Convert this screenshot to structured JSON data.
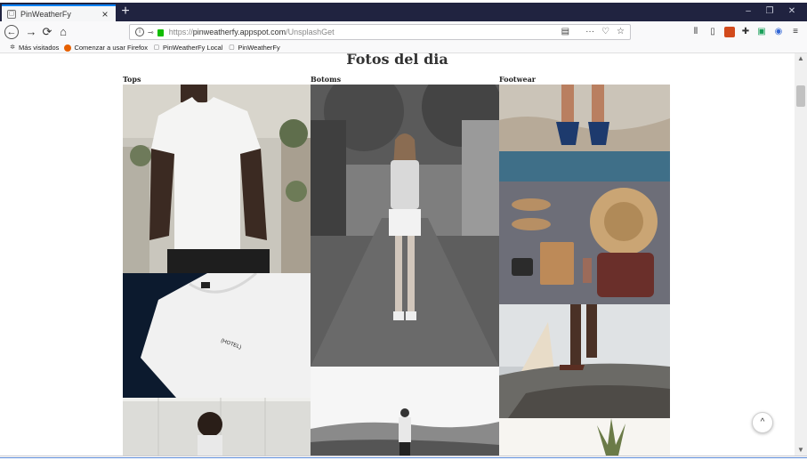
{
  "browser": {
    "tab": {
      "title": "PinWeatherFy",
      "close": "×"
    },
    "new_tab": "+",
    "window_controls": [
      "–",
      "❐",
      "✕"
    ],
    "url": {
      "prefix": "https://",
      "host": "pinweatherfy.appspot.com",
      "path": "/UnsplashGet"
    },
    "bookmarks": [
      {
        "label": "Más visitados",
        "icon": "gear-icon"
      },
      {
        "label": "Comenzar a usar Firefox",
        "icon": "firefox-icon"
      },
      {
        "label": "PinWeatherFy Local",
        "icon": "page-icon"
      },
      {
        "label": "PinWeatherFy",
        "icon": "page-icon"
      }
    ]
  },
  "page": {
    "title": "Fotos del dia",
    "columns": [
      {
        "heading": "Tops"
      },
      {
        "heading": "Botoms"
      },
      {
        "heading": "Footwear"
      }
    ],
    "shirt_print": "(HOTEL)",
    "scroll_top_label": "^"
  }
}
